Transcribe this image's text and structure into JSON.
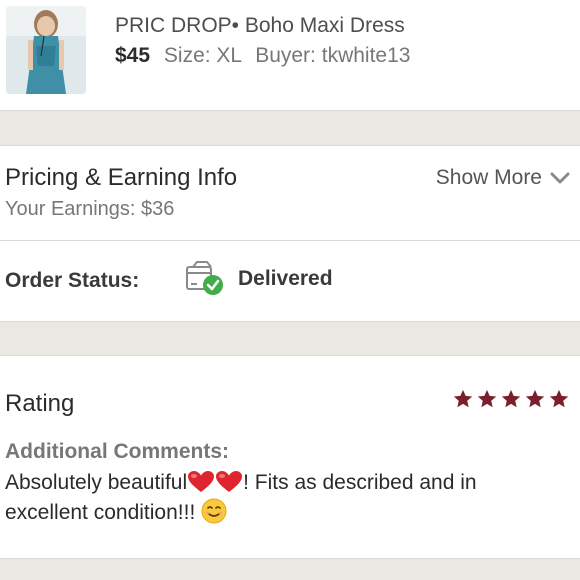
{
  "listing": {
    "title": "PRIC DROP• Boho Maxi Dress",
    "price": "$45",
    "size_label": "Size:",
    "size_value": "XL",
    "buyer_label": "Buyer:",
    "buyer_value": "tkwhite13"
  },
  "pricing": {
    "title": "Pricing & Earning Info",
    "earnings": "Your Earnings: $36",
    "show_more": "Show More"
  },
  "order": {
    "label": "Order Status:",
    "status": "Delivered",
    "status_icon": "package-delivered-icon",
    "check_color": "#3fae49"
  },
  "rating": {
    "title": "Rating",
    "stars": 5,
    "max_stars": 5,
    "star_color": "#7a1f2e",
    "comments_title": "Additional Comments:",
    "comment_part1": "Absolutely beautiful",
    "comment_part2": "! Fits as described and in excellent condition!!! ",
    "emoji": [
      "heart-emoji",
      "heart-emoji",
      "smiling-face-emoji"
    ]
  },
  "colors": {
    "background": "#ece9e4",
    "card": "#ffffff",
    "text": "#2b2b2b",
    "muted": "#777777"
  }
}
